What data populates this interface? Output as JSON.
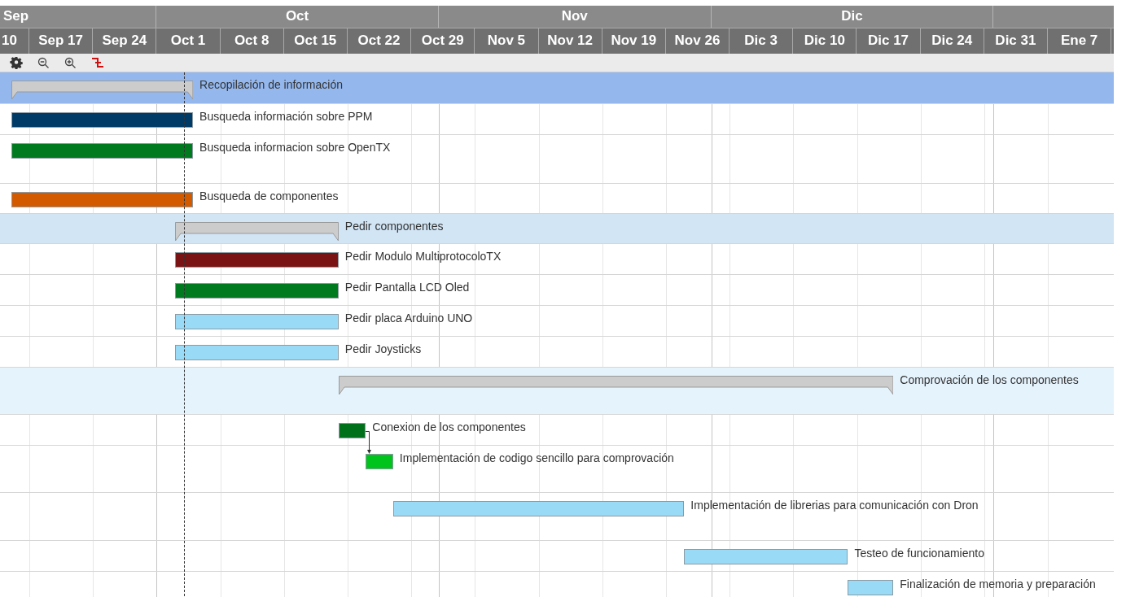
{
  "timeline": {
    "months": [
      {
        "label": "Sep"
      },
      {
        "label": "Oct"
      },
      {
        "label": "Nov"
      },
      {
        "label": "Dic"
      }
    ],
    "weeks": [
      "10",
      "Sep 17",
      "Sep 24",
      "Oct 1",
      "Oct 8",
      "Oct 15",
      "Oct 22",
      "Oct 29",
      "Nov 5",
      "Nov 12",
      "Nov 19",
      "Nov 26",
      "Dic 3",
      "Dic 10",
      "Dic 17",
      "Dic 24",
      "Dic 31",
      "Ene 7"
    ]
  },
  "tasks": [
    {
      "kind": "group",
      "name": "Recopilación de información",
      "color": "#94b8ee"
    },
    {
      "kind": "task",
      "name": "Busqueda información sobre PPM",
      "color": "#003a66"
    },
    {
      "kind": "task",
      "name": "Busqueda informacion sobre OpenTX",
      "color": "#007a1f"
    },
    {
      "kind": "task",
      "name": "Busqueda de componentes",
      "color": "#d45a00"
    },
    {
      "kind": "group",
      "name": "Pedir componentes",
      "color": "#d1e5f5"
    },
    {
      "kind": "task",
      "name": "Pedir Modulo MultiprotocoloTX",
      "color": "#7a1414"
    },
    {
      "kind": "task",
      "name": "Pedir Pantalla LCD Oled",
      "color": "#007a1f"
    },
    {
      "kind": "task",
      "name": "Pedir placa Arduino UNO",
      "color": "#99dbf7"
    },
    {
      "kind": "task",
      "name": "Pedir Joysticks",
      "color": "#99dbf7"
    },
    {
      "kind": "group",
      "name": "Comprovación de los componentes",
      "color": "#e5f3fd"
    },
    {
      "kind": "task",
      "name": "Conexion de los componentes",
      "color": "#00701a"
    },
    {
      "kind": "task",
      "name": "Implementación de codigo sencillo para comprovación",
      "color": "#00c31b",
      "depends_on_previous": true
    },
    {
      "kind": "task",
      "name": "Implementación de librerias para comunicación con Dron",
      "color": "#99dbf7"
    },
    {
      "kind": "task",
      "name": "Testeo de funcionamiento",
      "color": "#99dbf7"
    },
    {
      "kind": "task",
      "name": "Finalización de memoria y preparación",
      "color": "#99dbf7"
    }
  ]
}
